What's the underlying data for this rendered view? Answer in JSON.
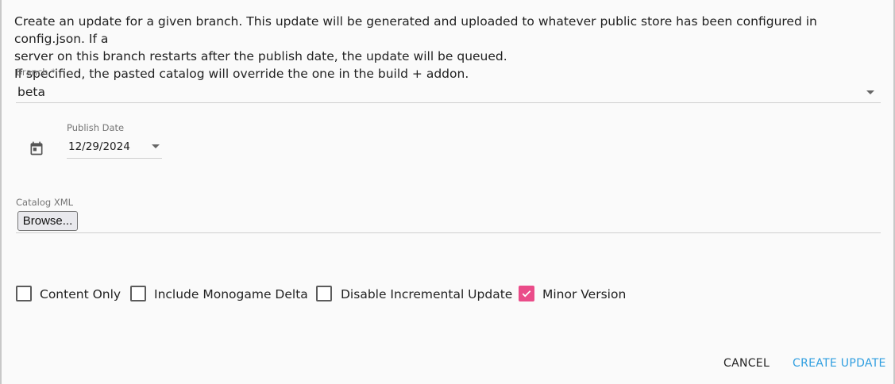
{
  "description": {
    "line1": "Create an update for a given branch. This update will be generated and uploaded to whatever public store has been configured in config.json. If a",
    "line2": "server on this branch restarts after the publish date, the update will be queued.",
    "line3": "If specified, the pasted catalog will override the one in the build + addon."
  },
  "branch": {
    "label": "Branch *",
    "value": "beta"
  },
  "publish_date": {
    "label": "Publish Date",
    "value": "12/29/2024",
    "icon": "calendar-icon"
  },
  "catalog": {
    "label": "Catalog XML",
    "browse_label": "Browse..."
  },
  "options": [
    {
      "label": "Content Only",
      "checked": false
    },
    {
      "label": "Include Monogame Delta",
      "checked": false
    },
    {
      "label": "Disable Incremental Update",
      "checked": false
    },
    {
      "label": "Minor Version",
      "checked": true
    }
  ],
  "actions": {
    "cancel": "CANCEL",
    "create": "CREATE UPDATE"
  },
  "colors": {
    "accent_pink": "#ea4c89",
    "accent_blue": "#2f9ee0"
  }
}
